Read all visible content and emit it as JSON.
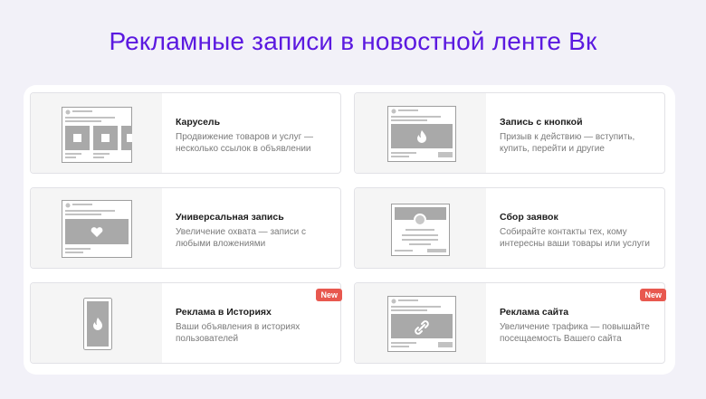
{
  "page": {
    "title": "Рекламные записи в новостной ленте Вк"
  },
  "cards": [
    {
      "title": "Карусель",
      "description": "Продвижение товаров и услуг — несколько ссылок в объявлении",
      "icon": "carousel-post-icon"
    },
    {
      "title": "Запись с кнопкой",
      "description": "Призыв к действию — вступить, купить, перейти и другие",
      "icon": "button-post-icon"
    },
    {
      "title": "Универсальная запись",
      "description": "Увеличение охвата — записи с любыми вложениями",
      "icon": "universal-post-icon"
    },
    {
      "title": "Сбор заявок",
      "description": "Собирайте контакты тех, кому интересны ваши товары или услуги",
      "icon": "lead-form-icon"
    },
    {
      "title": "Реклама в Историях",
      "description": "Ваши объявления в историях пользователей",
      "icon": "story-ad-icon",
      "badge": "New"
    },
    {
      "title": "Реклама сайта",
      "description": "Увеличение трафика — повышайте посещаемость Вашего сайта",
      "icon": "site-ad-icon",
      "badge": "New"
    }
  ],
  "colors": {
    "title": "#5b19e0",
    "background": "#f2f1f8",
    "badge": "#e8584f"
  }
}
